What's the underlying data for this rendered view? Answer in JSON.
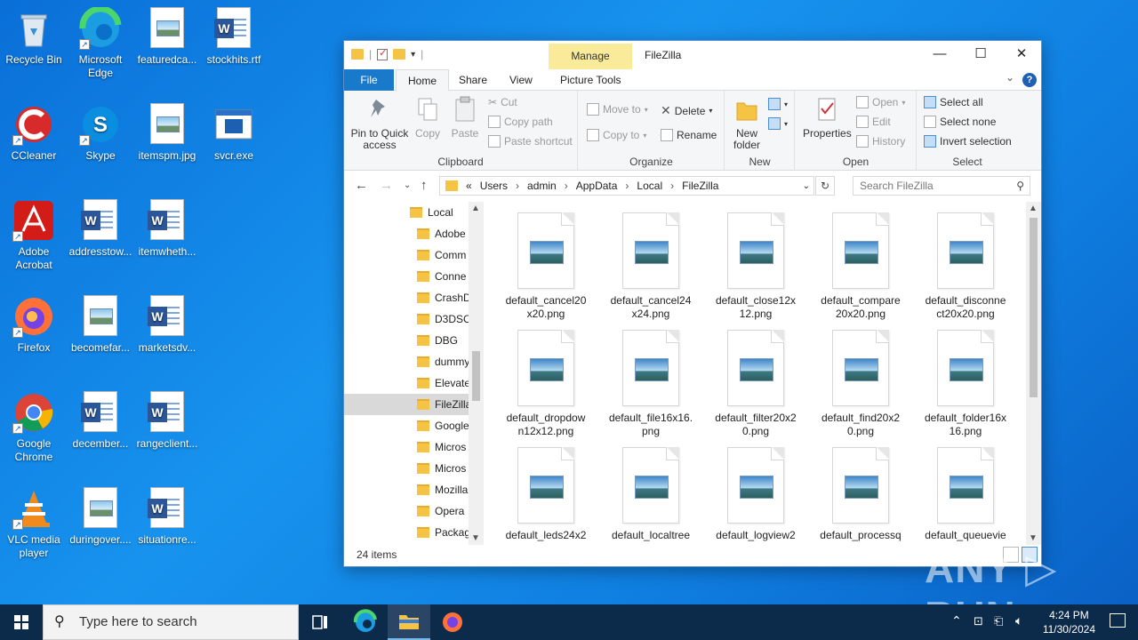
{
  "desktop": {
    "icons": [
      {
        "label": "Recycle Bin",
        "icon": "recycle-bin-icon"
      },
      {
        "label": "Microsoft Edge",
        "icon": "edge-icon"
      },
      {
        "label": "featuredca...",
        "icon": "image-file-icon"
      },
      {
        "label": "stockhits.rtf",
        "icon": "word-doc-icon"
      },
      {
        "label": "CCleaner",
        "icon": "ccleaner-icon"
      },
      {
        "label": "Skype",
        "icon": "skype-icon"
      },
      {
        "label": "itemspm.jpg",
        "icon": "image-file-icon"
      },
      {
        "label": "svcr.exe",
        "icon": "exe-icon"
      },
      {
        "label": "Adobe Acrobat",
        "icon": "acrobat-icon"
      },
      {
        "label": "addresstow...",
        "icon": "word-doc-icon"
      },
      {
        "label": "itemwheth...",
        "icon": "word-doc-icon"
      },
      {
        "label": "Firefox",
        "icon": "firefox-icon"
      },
      {
        "label": "becomefar...",
        "icon": "image-file-icon"
      },
      {
        "label": "marketsdv...",
        "icon": "word-doc-icon"
      },
      {
        "label": "Google Chrome",
        "icon": "chrome-icon"
      },
      {
        "label": "december...",
        "icon": "word-doc-icon"
      },
      {
        "label": "rangeclient...",
        "icon": "word-doc-icon"
      },
      {
        "label": "VLC media player",
        "icon": "vlc-icon"
      },
      {
        "label": "duringover....",
        "icon": "image-file-icon"
      },
      {
        "label": "situationre...",
        "icon": "word-doc-icon"
      }
    ]
  },
  "window": {
    "title": "FileZilla",
    "manage_tab": "Manage",
    "controls": {
      "minimize": "—",
      "maximize": "☐",
      "close": "✕"
    },
    "tabs": {
      "file": "File",
      "home": "Home",
      "share": "Share",
      "view": "View",
      "picture_tools": "Picture Tools"
    },
    "help": "?",
    "ribbon": {
      "clipboard": {
        "label": "Clipboard",
        "pin": "Pin to Quick access",
        "copy": "Copy",
        "paste": "Paste",
        "cut": "Cut",
        "copy_path": "Copy path",
        "paste_shortcut": "Paste shortcut"
      },
      "organize": {
        "label": "Organize",
        "move_to": "Move to",
        "copy_to": "Copy to",
        "delete": "Delete",
        "rename": "Rename"
      },
      "new": {
        "label": "New",
        "new_folder": "New folder"
      },
      "open": {
        "label": "Open",
        "properties": "Properties",
        "open": "Open",
        "edit": "Edit",
        "history": "History"
      },
      "select": {
        "label": "Select",
        "select_all": "Select all",
        "select_none": "Select none",
        "invert": "Invert selection"
      }
    },
    "address": {
      "prefix": "«",
      "crumbs": [
        "Users",
        "admin",
        "AppData",
        "Local",
        "FileZilla"
      ],
      "search_placeholder": "Search FileZilla"
    },
    "nav_tree": [
      "Local",
      "Adobe",
      "Comm",
      "Conne",
      "CrashD",
      "D3DSC",
      "DBG",
      "dummy",
      "Elevate",
      "FileZilla",
      "Google",
      "Micros",
      "Micros",
      "Mozilla",
      "Opera",
      "Packag"
    ],
    "files": [
      "default_cancel20x20.png",
      "default_cancel24x24.png",
      "default_close12x12.png",
      "default_compare20x20.png",
      "default_disconnect20x20.png",
      "default_dropdown12x12.png",
      "default_file16x16.png",
      "default_filter20x20.png",
      "default_find20x20.png",
      "default_folder16x16.png",
      "default_leds24x2",
      "default_localtree",
      "default_logview2",
      "default_processq",
      "default_queuevie"
    ],
    "file_labels": [
      [
        "default_cancel20",
        "x20.png"
      ],
      [
        "default_cancel24",
        "x24.png"
      ],
      [
        "default_close12x",
        "12.png"
      ],
      [
        "default_compare",
        "20x20.png"
      ],
      [
        "default_disconne",
        "ct20x20.png"
      ],
      [
        "default_dropdow",
        "n12x12.png"
      ],
      [
        "default_file16x16.",
        "png"
      ],
      [
        "default_filter20x2",
        "0.png"
      ],
      [
        "default_find20x2",
        "0.png"
      ],
      [
        "default_folder16x",
        "16.png"
      ],
      [
        "default_leds24x2",
        ""
      ],
      [
        "default_localtree",
        ""
      ],
      [
        "default_logview2",
        ""
      ],
      [
        "default_processq",
        ""
      ],
      [
        "default_queuevie",
        ""
      ]
    ],
    "status": "24 items"
  },
  "taskbar": {
    "search_placeholder": "Type here to search",
    "time": "4:24 PM",
    "date": "11/30/2024"
  },
  "watermark": "ANY ▷ RUN",
  "colors": {
    "accent": "#1979ca",
    "manage": "#f9eb9a",
    "folder": "#f6c445"
  }
}
